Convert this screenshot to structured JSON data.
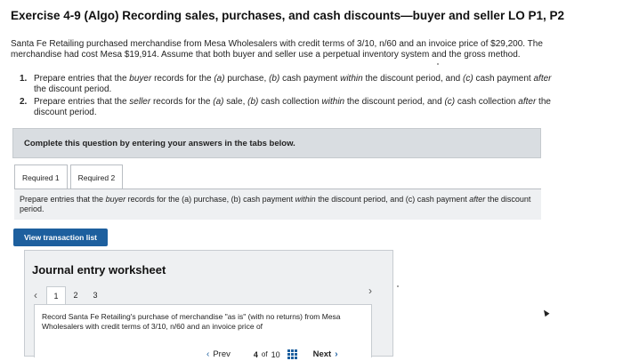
{
  "title": "Exercise 4-9 (Algo) Recording sales, purchases, and cash discounts—buyer and seller LO P1, P2",
  "intro": "Santa Fe Retailing purchased merchandise from Mesa Wholesalers with credit terms of 3/10, n/60 and an invoice price of $29,200. The merchandise had cost Mesa $19,914. Assume that both buyer and seller use a perpetual inventory system and the gross method.",
  "steps": [
    {
      "num": "1.",
      "parts": [
        "Prepare entries that the ",
        "buyer",
        " records for the ",
        "(a)",
        " purchase, ",
        "(b)",
        " cash payment ",
        "within",
        " the discount period, and ",
        "(c)",
        " cash payment ",
        "after",
        " the discount period."
      ]
    },
    {
      "num": "2.",
      "parts": [
        "Prepare entries that the ",
        "seller",
        " records for the ",
        "(a)",
        " sale, ",
        "(b)",
        " cash collection ",
        "within",
        " the discount period, and ",
        "(c)",
        " cash collection ",
        "after",
        " the discount period."
      ]
    }
  ],
  "complete_bar": "Complete this question by entering your answers in the tabs below.",
  "tabs": [
    {
      "label": "Required 1",
      "active": true
    },
    {
      "label": "Required 2",
      "active": false
    }
  ],
  "tab_panel_parts": [
    "Prepare entries that the ",
    "buyer",
    " records for the (a) purchase, (b) cash payment ",
    "within",
    " the discount period, and (c) cash payment ",
    "after",
    " the discount period."
  ],
  "view_button": "View transaction list",
  "worksheet": {
    "title": "Journal entry worksheet",
    "pages": [
      "1",
      "2",
      "3"
    ],
    "current_page": "1",
    "body": "Record Santa Fe Retailing's purchase of merchandise \"as is\" (with no returns) from Mesa Wholesalers with credit terms of 3/10, n/60 and an invoice price of"
  },
  "pager": {
    "prev": "Prev",
    "current": "4",
    "of": "of",
    "total": "10",
    "next": "Next"
  },
  "colors": {
    "accent": "#1d5f9e",
    "bar_bg": "#d9dde1",
    "panel_bg": "#eef0f2"
  }
}
